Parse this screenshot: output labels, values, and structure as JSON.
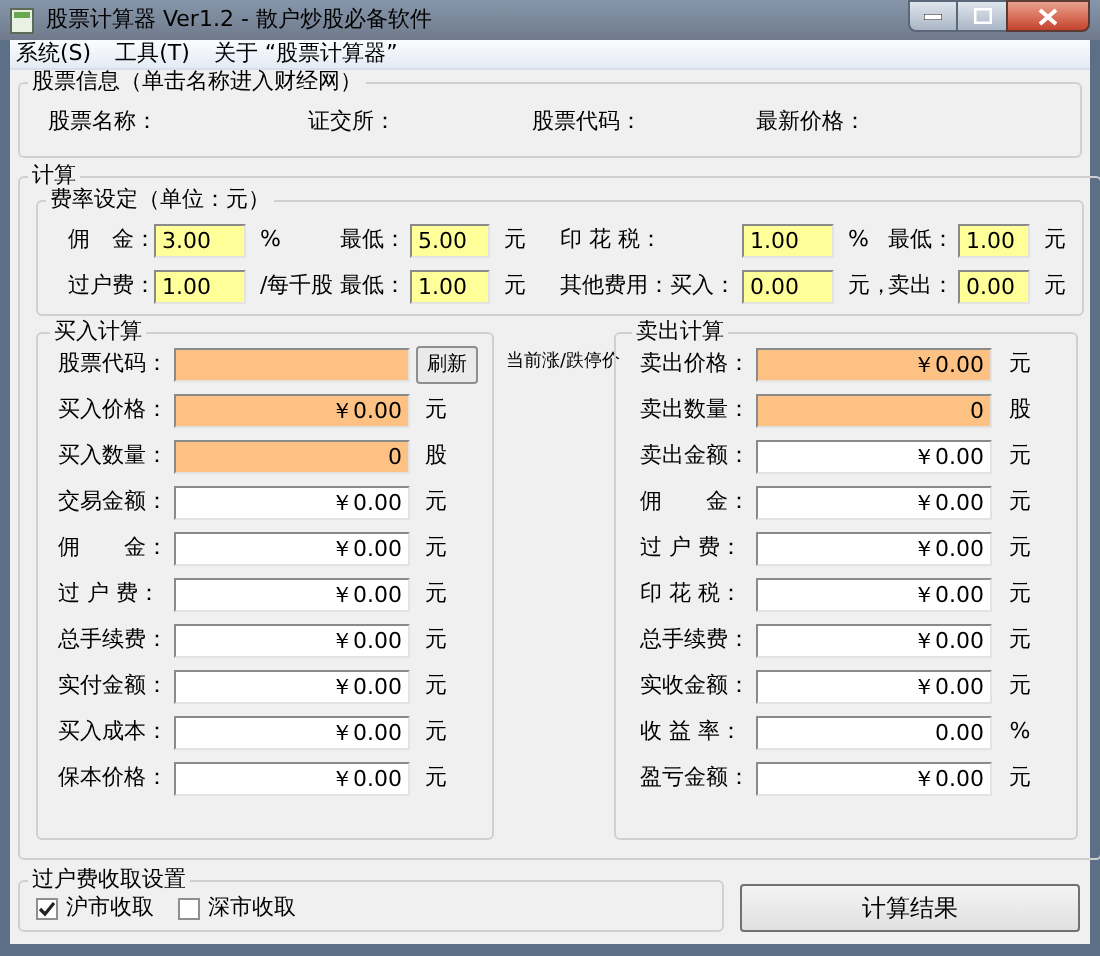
{
  "window": {
    "title": "股票计算器 Ver1.2 - 散户炒股必备软件"
  },
  "menu": [
    {
      "label": "系统(S)"
    },
    {
      "label": "工具(T)"
    },
    {
      "label": "关于 “股票计算器”"
    }
  ],
  "stock_info": {
    "title": "股票信息（单击名称进入财经网）",
    "labels": [
      "股票名称：",
      "证交所：",
      "股票代码：",
      "最新价格："
    ]
  },
  "calc": {
    "title": "计算",
    "fees": {
      "title": "费率设定（单位：元）",
      "rows": [
        [
          {
            "kind": "label",
            "text": "佣　金："
          },
          {
            "kind": "field",
            "value": "3.00"
          },
          {
            "kind": "label",
            "text": "%"
          },
          {
            "kind": "label",
            "text": "最低："
          },
          {
            "kind": "field",
            "value": "5.00"
          },
          {
            "kind": "label",
            "text": "元"
          },
          {
            "kind": "label",
            "text": "印 花 税："
          },
          {
            "kind": "field",
            "value": "1.00"
          },
          {
            "kind": "label",
            "text": "%"
          },
          {
            "kind": "label",
            "text": "最低："
          },
          {
            "kind": "field",
            "value": "1.00"
          },
          {
            "kind": "label",
            "text": "元"
          }
        ],
        [
          {
            "kind": "label",
            "text": "过户费："
          },
          {
            "kind": "field",
            "value": "1.00"
          },
          {
            "kind": "label",
            "text": "/每千股"
          },
          {
            "kind": "label",
            "text": "最低："
          },
          {
            "kind": "field",
            "value": "1.00"
          },
          {
            "kind": "label",
            "text": "元"
          },
          {
            "kind": "label",
            "text": "其他费用：买入："
          },
          {
            "kind": "field",
            "value": "0.00"
          },
          {
            "kind": "label",
            "text": "元，"
          },
          {
            "kind": "label",
            "text": "卖出："
          },
          {
            "kind": "field",
            "value": "0.00"
          },
          {
            "kind": "label",
            "text": "元"
          }
        ]
      ]
    },
    "middle_label": "当前涨/跌停价",
    "buy": {
      "title": "买入计算",
      "rows": [
        {
          "label": "股票代码：",
          "value": "",
          "editable": true,
          "button": "刷新"
        },
        {
          "label": "买入价格：",
          "value": "￥0.00",
          "editable": true,
          "unit": "元"
        },
        {
          "label": "买入数量：",
          "value": "0",
          "editable": true,
          "unit": "股"
        },
        {
          "label": "交易金额：",
          "value": "￥0.00",
          "editable": false,
          "unit": "元"
        },
        {
          "label": "佣　　金：",
          "value": "￥0.00",
          "editable": false,
          "unit": "元"
        },
        {
          "label": "过 户 费：",
          "value": "￥0.00",
          "editable": false,
          "unit": "元"
        },
        {
          "label": "总手续费：",
          "value": "￥0.00",
          "editable": false,
          "unit": "元"
        },
        {
          "label": "实付金额：",
          "value": "￥0.00",
          "editable": false,
          "unit": "元"
        },
        {
          "label": "买入成本：",
          "value": "￥0.00",
          "editable": false,
          "unit": "元"
        },
        {
          "label": "保本价格：",
          "value": "￥0.00",
          "editable": false,
          "unit": "元"
        }
      ]
    },
    "sell": {
      "title": "卖出计算",
      "rows": [
        {
          "label": "卖出价格：",
          "value": "￥0.00",
          "editable": true,
          "unit": "元"
        },
        {
          "label": "卖出数量：",
          "value": "0",
          "editable": true,
          "unit": "股"
        },
        {
          "label": "卖出金额：",
          "value": "￥0.00",
          "editable": false,
          "unit": "元"
        },
        {
          "label": "佣　　金：",
          "value": "￥0.00",
          "editable": false,
          "unit": "元"
        },
        {
          "label": "过 户 费：",
          "value": "￥0.00",
          "editable": false,
          "unit": "元"
        },
        {
          "label": "印 花 税：",
          "value": "￥0.00",
          "editable": false,
          "unit": "元"
        },
        {
          "label": "总手续费：",
          "value": "￥0.00",
          "editable": false,
          "unit": "元"
        },
        {
          "label": "实收金额：",
          "value": "￥0.00",
          "editable": false,
          "unit": "元"
        },
        {
          "label": "收 益 率：",
          "value": "0.00",
          "editable": false,
          "unit": "%"
        },
        {
          "label": "盈亏金额：",
          "value": "￥0.00",
          "editable": false,
          "unit": "元"
        }
      ]
    }
  },
  "transfer_settings": {
    "title": "过户费收取设置",
    "options": [
      {
        "label": "沪市收取",
        "checked": true
      },
      {
        "label": "深市收取",
        "checked": false
      }
    ]
  },
  "calculate_button": "计算结果"
}
